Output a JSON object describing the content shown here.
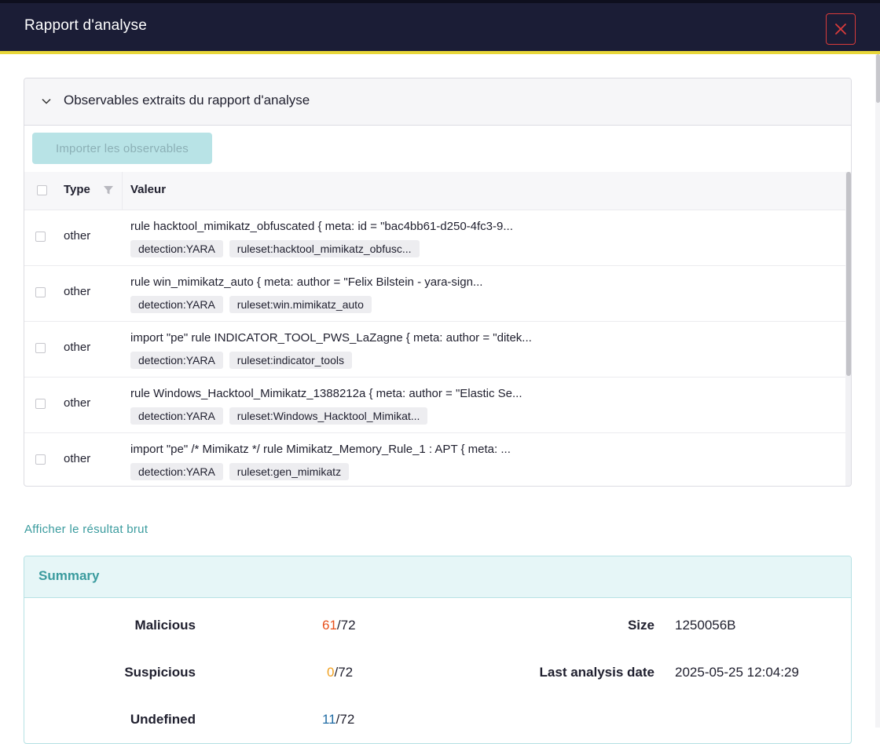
{
  "header": {
    "title": "Rapport d'analyse"
  },
  "observables": {
    "title": "Observables extraits du rapport d'analyse",
    "import_label": "Importer les observables",
    "columns": {
      "type": "Type",
      "value": "Valeur"
    },
    "rows": [
      {
        "type": "other",
        "value": "rule hacktool_mimikatz_obfuscated { meta: id = \"bac4bb61-d250-4fc3-9...",
        "tags": [
          "detection:YARA",
          "ruleset:hacktool_mimikatz_obfusc..."
        ]
      },
      {
        "type": "other",
        "value": "rule win_mimikatz_auto { meta: author = \"Felix Bilstein - yara-sign...",
        "tags": [
          "detection:YARA",
          "ruleset:win.mimikatz_auto"
        ]
      },
      {
        "type": "other",
        "value": "import \"pe\" rule INDICATOR_TOOL_PWS_LaZagne { meta: author = \"ditek...",
        "tags": [
          "detection:YARA",
          "ruleset:indicator_tools"
        ]
      },
      {
        "type": "other",
        "value": "rule Windows_Hacktool_Mimikatz_1388212a { meta: author = \"Elastic Se...",
        "tags": [
          "detection:YARA",
          "ruleset:Windows_Hacktool_Mimikat..."
        ]
      },
      {
        "type": "other",
        "value": "import \"pe\" /* Mimikatz */ rule Mimikatz_Memory_Rule_1 : APT { meta: ...",
        "tags": [
          "detection:YARA",
          "ruleset:gen_mimikatz"
        ]
      }
    ]
  },
  "raw_link": "Afficher le résultat brut",
  "summary": {
    "title": "Summary",
    "malicious": {
      "label": "Malicious",
      "count": "61",
      "total": "/72"
    },
    "suspicious": {
      "label": "Suspicious",
      "count": "0",
      "total": "/72"
    },
    "undefined": {
      "label": "Undefined",
      "count": "11",
      "total": "/72"
    },
    "size": {
      "label": "Size",
      "value": "1250056B"
    },
    "last_analysis": {
      "label": "Last analysis date",
      "value": "2025-05-25 12:04:29"
    }
  },
  "colors": {
    "header_bg": "#1b1d36",
    "accent": "#e8d73a",
    "teal": "#3a9b9e",
    "malicious": "#e8501c",
    "suspicious": "#f0a020",
    "undefined": "#1e6aa3"
  }
}
